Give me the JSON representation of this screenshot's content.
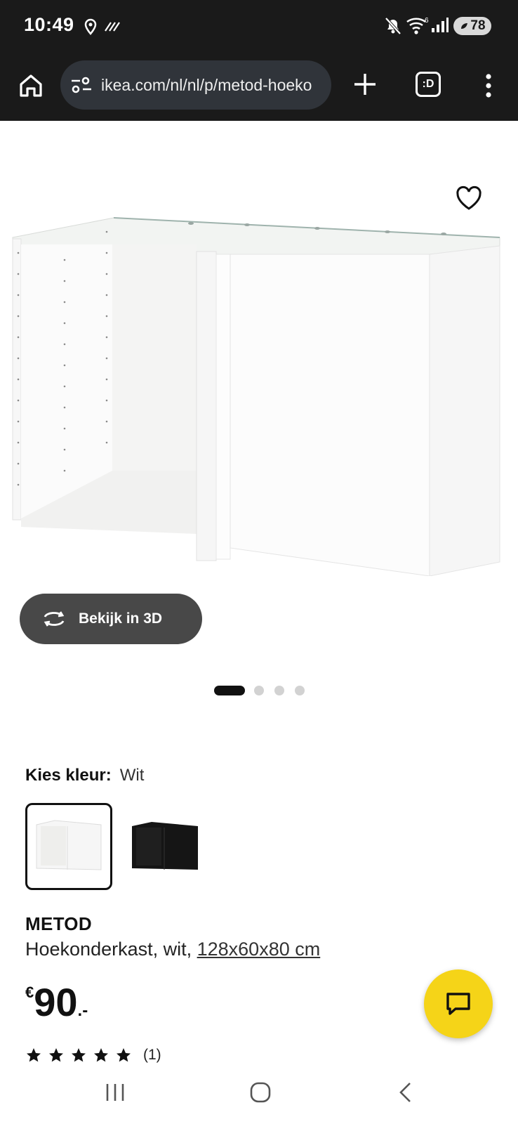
{
  "status_bar": {
    "time": "10:49",
    "battery": "78",
    "icons": [
      "location-icon",
      "data-saver-icon",
      "mute-icon",
      "wifi-icon",
      "signal-icon",
      "battery-icon"
    ]
  },
  "browser": {
    "url": "ikea.com/nl/nl/p/metod-hoeko",
    "tab_label": ":D",
    "icons": [
      "home-icon",
      "site-settings-icon",
      "plus-icon",
      "tabs-icon",
      "more-vert-icon"
    ]
  },
  "gallery": {
    "view3d_label": "Bekijk in 3D",
    "dots": {
      "count": 4,
      "active_index": 0
    }
  },
  "color": {
    "label": "Kies kleur:",
    "value": "Wit",
    "swatches": [
      "white-cabinet",
      "black-cabinet"
    ],
    "selected_index": 0
  },
  "product": {
    "name": "METOD",
    "description": "Hoekonderkast, wit, ",
    "dimensions": "128x60x80 cm",
    "price_currency": "€",
    "price_amount": "90",
    "price_suffix": ".-",
    "rating": {
      "stars": 5,
      "max": 5,
      "count_label": "(1)"
    }
  },
  "colors": {
    "accent_yellow": "#f5d418",
    "dark_bar": "#1a1a1a",
    "button_gray": "#484848"
  }
}
